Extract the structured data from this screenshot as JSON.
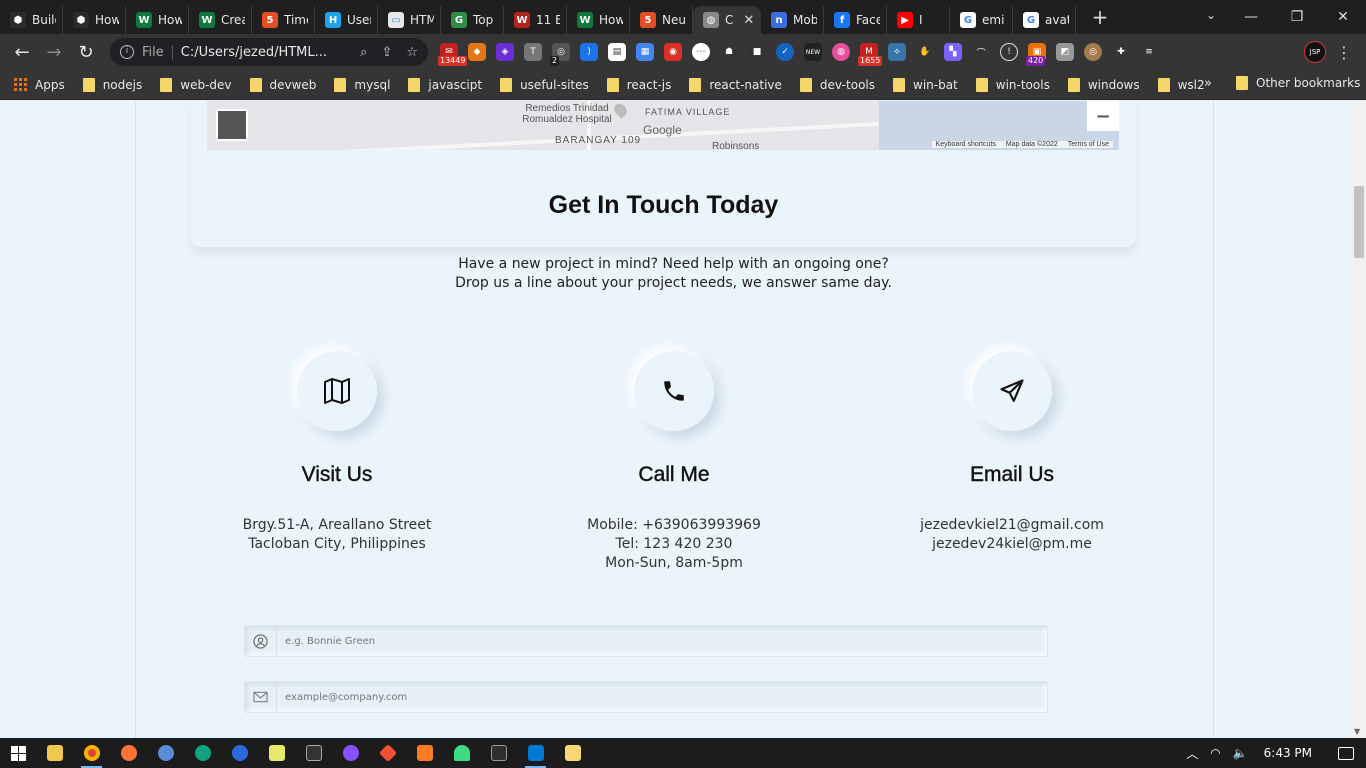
{
  "browser": {
    "tabs": [
      {
        "label": "Build",
        "color": "#2b2b2b",
        "glyph": "⬢"
      },
      {
        "label": "How",
        "color": "#2b2b2b",
        "glyph": "⬢"
      },
      {
        "label": "How",
        "color": "#0e7a3d",
        "glyph": "W"
      },
      {
        "label": "Crea",
        "color": "#0e7a3d",
        "glyph": "W"
      },
      {
        "label": "Time",
        "color": "#e44d26",
        "glyph": "5"
      },
      {
        "label": "User",
        "color": "#1fa3e8",
        "glyph": "H"
      },
      {
        "label": "HTM",
        "color": "#e8e8e8",
        "glyph": "▭"
      },
      {
        "label": "Top",
        "color": "#2f8d46",
        "glyph": "G"
      },
      {
        "label": "11 E",
        "color": "#b3261e",
        "glyph": "W"
      },
      {
        "label": "How",
        "color": "#0e7a3d",
        "glyph": "W"
      },
      {
        "label": "Neu",
        "color": "#e44d26",
        "glyph": "5"
      },
      {
        "label": "C",
        "color": "#888888",
        "glyph": "◍",
        "active": true
      },
      {
        "label": "Mob",
        "color": "#3b6fe0",
        "glyph": "n"
      },
      {
        "label": "Face",
        "color": "#1877f2",
        "glyph": "f"
      },
      {
        "label": "I",
        "color": "#ff0000",
        "glyph": "▶"
      },
      {
        "label": "emi",
        "color": "#ffffff",
        "glyph": "G"
      },
      {
        "label": "avat",
        "color": "#ffffff",
        "glyph": "G"
      }
    ],
    "address": {
      "scheme_label": "File",
      "url": "C:/Users/jezed/HTML..."
    },
    "extension_badges": {
      "mail": "13449",
      "multi": "2",
      "new": "NEW",
      "gmail": "1655",
      "feed": "420"
    },
    "profile_label": "JSP",
    "bookmarks": [
      "nodejs",
      "web-dev",
      "devweb",
      "mysql",
      "javascipt",
      "useful-sites",
      "react-js",
      "react-native",
      "dev-tools",
      "win-bat",
      "win-tools",
      "windows",
      "wsl2"
    ],
    "apps_label": "Apps",
    "more_label": "»",
    "other_bookmarks": "Other bookmarks"
  },
  "map": {
    "hospital": "Remedios Trinidad Romualdez Hospital",
    "village": "FATIMA VILLAGE",
    "barangay": "BARANGAY 109",
    "robinsons": "Robinsons",
    "google": "Google",
    "shortcuts": "Keyboard shortcuts",
    "mapdata": "Map data ©2022",
    "terms": "Terms of Use",
    "zoom_out": "−"
  },
  "contact": {
    "title": "Get In Touch Today",
    "intro_line1": "Have a new project in mind? Need help with an ongoing one?",
    "intro_line2": "Drop us a line about your project needs, we answer same day.",
    "cards": [
      {
        "icon": "map-icon",
        "heading": "Visit Us",
        "lines": [
          "Brgy.51-A, Areallano Street",
          "Tacloban City, Philippines"
        ]
      },
      {
        "icon": "phone-icon",
        "heading": "Call Me",
        "lines": [
          "Mobile: +639063993969",
          "Tel: 123 420 230",
          "Mon-Sun, 8am-5pm"
        ]
      },
      {
        "icon": "send-icon",
        "heading": "Email Us",
        "lines": [
          "jezedevkiel21@gmail.com",
          "jezedev24kiel@pm.me"
        ]
      }
    ],
    "form": {
      "name_placeholder": "e.g. Bonnie Green",
      "email_placeholder": "example@company.com"
    }
  },
  "taskbar": {
    "time": "6:43 PM"
  }
}
